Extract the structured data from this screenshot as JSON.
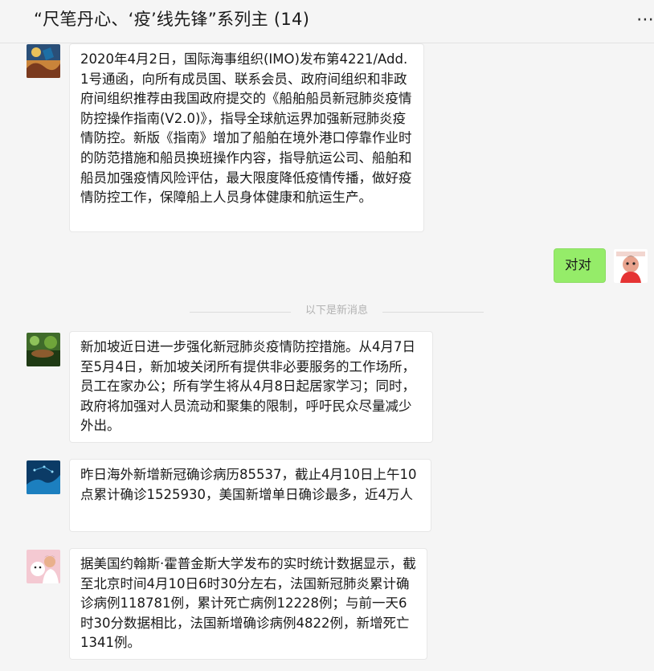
{
  "header": {
    "title": "“尺笔丹心、‘疫’线先锋”系列主 (14)",
    "more_icon": "⋯"
  },
  "messages": [
    {
      "sender": "other",
      "text": "2020年4月2日，国际海事组织(IMO)发布第4221/Add.1号通函，向所有成员国、联系会员、政府间组织和非政府间组织推荐由我国政府提交的《船舶船员新冠肺炎疫情防控操作指南(V2.0)》，指导全球航运界加强新冠肺炎疫情防控。新版《指南》增加了船舶在境外港口停靠作业时的防范措施和船员换班操作内容，指导航运公司、船舶和船员加强疫情风险评估，最大限度降低疫情传播，做好疫情防控工作，保障船上人员身体健康和航运生产。"
    },
    {
      "sender": "self",
      "text": "对对"
    },
    {
      "sender": "other",
      "text": "新加坡近日进一步强化新冠肺炎疫情防控措施。从4月7日至5月4日，新加坡关闭所有提供非必要服务的工作场所，员工在家办公；所有学生将从4月8日起居家学习；同时，政府将加强对人员流动和聚集的限制，呼吁民众尽量减少外出。"
    },
    {
      "sender": "other",
      "text": "昨日海外新增新冠确诊病历85537，截止4月10日上午10点累计确诊1525930，美国新增单日确诊最多，近4万人"
    },
    {
      "sender": "other",
      "text": "据美国约翰斯·霍普金斯大学发布的实时统计数据显示，截至北京时间4月10日6时30分左右，法国新冠肺炎累计确诊病例118781例，累计死亡病例12228例；与前一天6时30分数据相比，法国新增确诊病例4822例，新增死亡1341例。"
    }
  ],
  "divider": {
    "label": "以下是新消息"
  },
  "colors": {
    "background": "#f5f5f5",
    "bubble_other": "#ffffff",
    "bubble_self": "#95ec69",
    "divider_text": "#b2b2b2"
  }
}
